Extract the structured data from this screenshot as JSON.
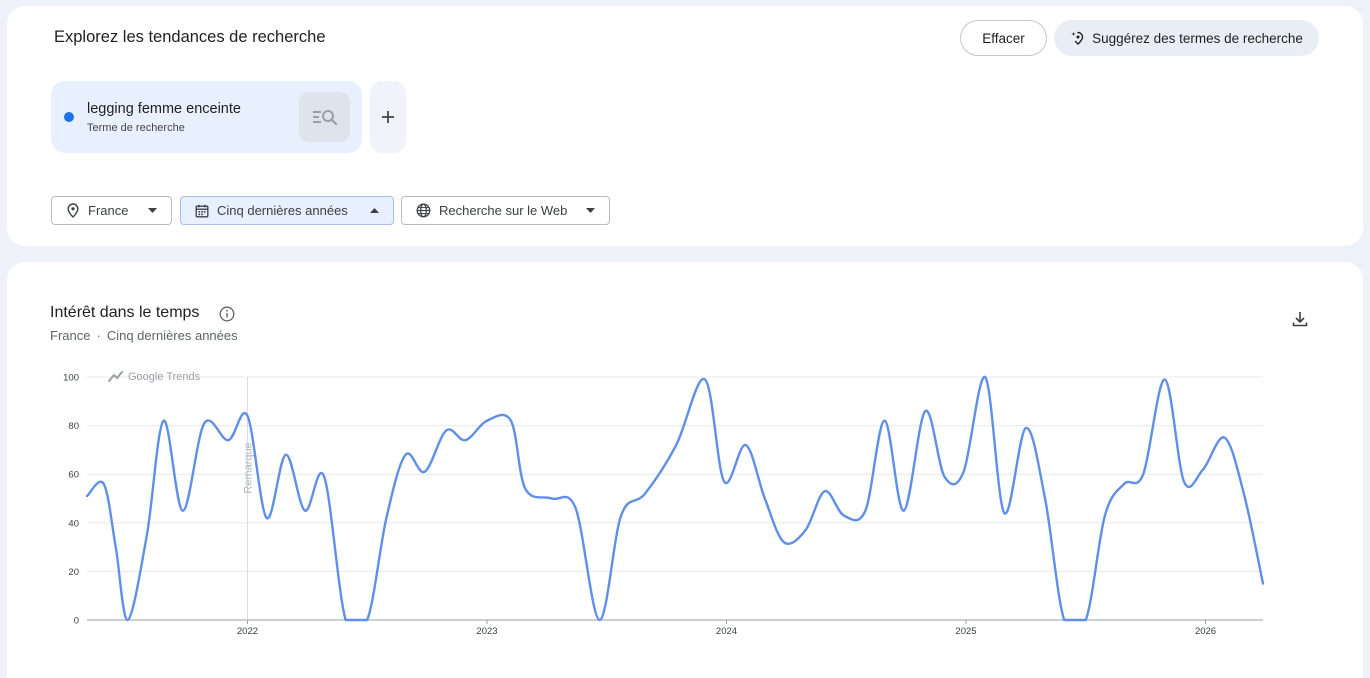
{
  "explore": {
    "title": "Explorez les tendances de recherche",
    "clear_label": "Effacer",
    "suggest_label": "Suggérez des termes de recherche",
    "term": {
      "name": "legging femme enceinte",
      "subtitle": "Terme de recherche",
      "color": "#1a73e8"
    },
    "add_label": "+",
    "filters": {
      "geo": "France",
      "time": "Cinq dernières années",
      "property": "Recherche sur le Web"
    }
  },
  "interest": {
    "title": "Intérêt dans le temps",
    "subtitle_geo": "France",
    "subtitle_sep": "·",
    "subtitle_time": "Cinq dernières années",
    "watermark": "Google Trends",
    "note_label": "Remarque"
  },
  "chart_data": {
    "type": "line",
    "series": [
      {
        "name": "legging femme enceinte",
        "color": "#5f8fe6",
        "points": [
          [
            2021.33,
            51
          ],
          [
            2021.4,
            56
          ],
          [
            2021.45,
            30
          ],
          [
            2021.5,
            0
          ],
          [
            2021.58,
            35
          ],
          [
            2021.65,
            82
          ],
          [
            2021.73,
            45
          ],
          [
            2021.82,
            81
          ],
          [
            2021.92,
            74
          ],
          [
            2022.0,
            84
          ],
          [
            2022.08,
            42
          ],
          [
            2022.16,
            68
          ],
          [
            2022.24,
            45
          ],
          [
            2022.32,
            59
          ],
          [
            2022.41,
            0
          ],
          [
            2022.5,
            0
          ],
          [
            2022.58,
            42
          ],
          [
            2022.66,
            68
          ],
          [
            2022.74,
            61
          ],
          [
            2022.83,
            78
          ],
          [
            2022.91,
            74
          ],
          [
            2023.0,
            82
          ],
          [
            2023.1,
            82
          ],
          [
            2023.16,
            54
          ],
          [
            2023.27,
            50
          ],
          [
            2023.37,
            46
          ],
          [
            2023.47,
            0
          ],
          [
            2023.56,
            43
          ],
          [
            2023.66,
            52
          ],
          [
            2023.79,
            72
          ],
          [
            2023.91,
            99
          ],
          [
            2023.99,
            57
          ],
          [
            2024.08,
            72
          ],
          [
            2024.16,
            50
          ],
          [
            2024.24,
            32
          ],
          [
            2024.33,
            37
          ],
          [
            2024.41,
            53
          ],
          [
            2024.49,
            43
          ],
          [
            2024.58,
            45
          ],
          [
            2024.66,
            82
          ],
          [
            2024.74,
            45
          ],
          [
            2024.83,
            86
          ],
          [
            2024.91,
            59
          ],
          [
            2024.99,
            61
          ],
          [
            2025.08,
            100
          ],
          [
            2025.16,
            44
          ],
          [
            2025.25,
            79
          ],
          [
            2025.33,
            50
          ],
          [
            2025.41,
            0
          ],
          [
            2025.5,
            0
          ],
          [
            2025.58,
            43
          ],
          [
            2025.66,
            56
          ],
          [
            2025.74,
            60
          ],
          [
            2025.83,
            99
          ],
          [
            2025.91,
            57
          ],
          [
            2025.99,
            62
          ],
          [
            2026.08,
            75
          ],
          [
            2026.16,
            52
          ],
          [
            2026.24,
            15
          ]
        ]
      }
    ],
    "x_tick_labels": [
      "2022",
      "2023",
      "2024",
      "2025",
      "2026"
    ],
    "x_ticks": [
      2022,
      2023,
      2024,
      2025,
      2026
    ],
    "xlim": [
      2021.33,
      2026.24
    ],
    "y_ticks": [
      0,
      20,
      40,
      60,
      80,
      100
    ],
    "ylim": [
      0,
      100
    ],
    "grid": true,
    "annotation": {
      "x": 2022.0,
      "label": "Remarque"
    }
  }
}
